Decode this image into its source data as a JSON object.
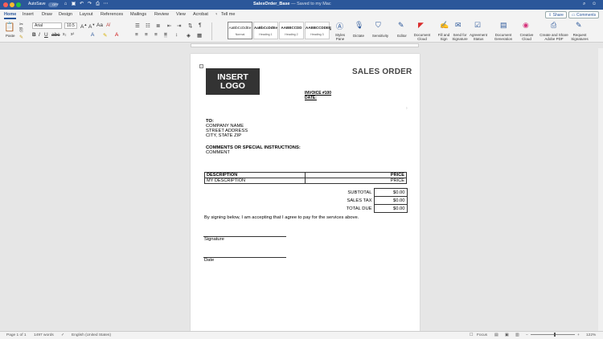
{
  "titlebar": {
    "autosave_label": "AutoSave",
    "autosave_state": "OFF",
    "doc_name": "SalesOrder_Base",
    "save_status": "— Saved to my Mac"
  },
  "tabs": [
    "Home",
    "Insert",
    "Draw",
    "Design",
    "Layout",
    "References",
    "Mailings",
    "Review",
    "View",
    "Acrobat"
  ],
  "tell_me": "Tell me",
  "share_label": "Share",
  "comments_label": "Comments",
  "ribbon": {
    "paste": "Paste",
    "font": "Arial",
    "size": "10.5",
    "styles": [
      {
        "sample": "AaBbCcDdEe",
        "name": "Normal"
      },
      {
        "sample": "AaBbCcDdEe",
        "name": "Heading 1"
      },
      {
        "sample": "AABBCCDD",
        "name": "Heading 2"
      },
      {
        "sample": "AABBCCDDEE",
        "name": "Heading 3"
      }
    ],
    "styles_pane": "Styles Pane",
    "dictate": "Dictate",
    "sensitivity": "Sensitivity",
    "editor": "Editor",
    "document_cloud": "Document Cloud",
    "fill_sign": "Fill and Sign",
    "send_signature": "Send for Signature",
    "agreement_status": "Agreement Status",
    "document_generation": "Document Generation",
    "creative_cloud": "Creative Cloud",
    "create_share_pdf": "Create and Share Adobe PDF",
    "request_signatures": "Request Signatures"
  },
  "document": {
    "logo_line1": "INSERT",
    "logo_line2": "LOGO",
    "title": "SALES ORDER",
    "invoice": "INVOICE #100",
    "date": "DATE:",
    "to_label": "TO:",
    "company": "COMPANY NAME",
    "street": "STREET ADDRESS",
    "city": "CITY, STATE ZIP",
    "comments_label": "COMMENTS OR SPECIAL INSTRUCTIONS:",
    "comment": "COMMENT",
    "table_headers": [
      "DESCRIPTION",
      "PRICE"
    ],
    "table_row": [
      "MY DESCRIPTION",
      "PRICE"
    ],
    "totals": [
      {
        "label": "SUBTOTAL",
        "value": "$0.00"
      },
      {
        "label": "SALES TAX",
        "value": "$0.00"
      },
      {
        "label": "TOTAL DUE",
        "value": "$0.00"
      }
    ],
    "agreement": "By signing below, I am accepting that I agree to pay for the services above.",
    "signature_label": "Signature",
    "date_label": "Date"
  },
  "statusbar": {
    "page": "Page 1 of 1",
    "words": "1497 words",
    "language": "English (United States)",
    "focus": "Focus",
    "zoom": "122%"
  }
}
